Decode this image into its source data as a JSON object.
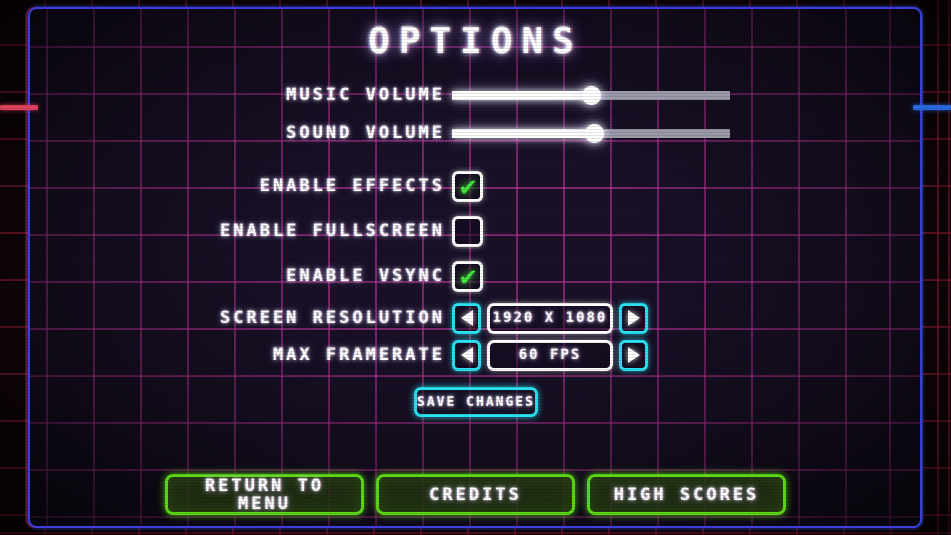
{
  "screen": {
    "title": "OPTIONS",
    "accent_cyan": "#2ce0f0",
    "accent_green": "#5dd817",
    "accent_frame": "#3d3fe0",
    "grid_inner": "#cd37a5",
    "grid_outer": "#d22846",
    "check_green": "#44e53c"
  },
  "settings": {
    "music_volume": {
      "label": "MUSIC  VOLUME",
      "value_percent": 50,
      "icon": "slider-handle-icon"
    },
    "sound_volume": {
      "label": "SOUND  VOLUME",
      "value_percent": 51,
      "icon": "slider-handle-icon"
    },
    "enable_effects": {
      "label": "ENABLE  EFFECTS",
      "checked": true,
      "check_glyph": "✔"
    },
    "enable_fullscreen": {
      "label": "ENABLE  FULLSCREEN",
      "checked": false,
      "check_glyph": "✔"
    },
    "enable_vsync": {
      "label": "ENABLE  VSYNC",
      "checked": true,
      "check_glyph": "✔"
    },
    "screen_resolution": {
      "label": "SCREEN  RESOLUTION",
      "value": "1920 X 1080",
      "prev_icon": "triangle-left-icon",
      "next_icon": "triangle-right-icon"
    },
    "max_framerate": {
      "label": "MAX  FRAMERATE",
      "value": "60 FPS",
      "prev_icon": "triangle-left-icon",
      "next_icon": "triangle-right-icon"
    }
  },
  "actions": {
    "save_changes": "SAVE CHANGES",
    "return_to_menu_line1": "RETURN TO",
    "return_to_menu_line2": "MENU",
    "credits": "CREDITS",
    "high_scores": "HIGH SCORES"
  }
}
